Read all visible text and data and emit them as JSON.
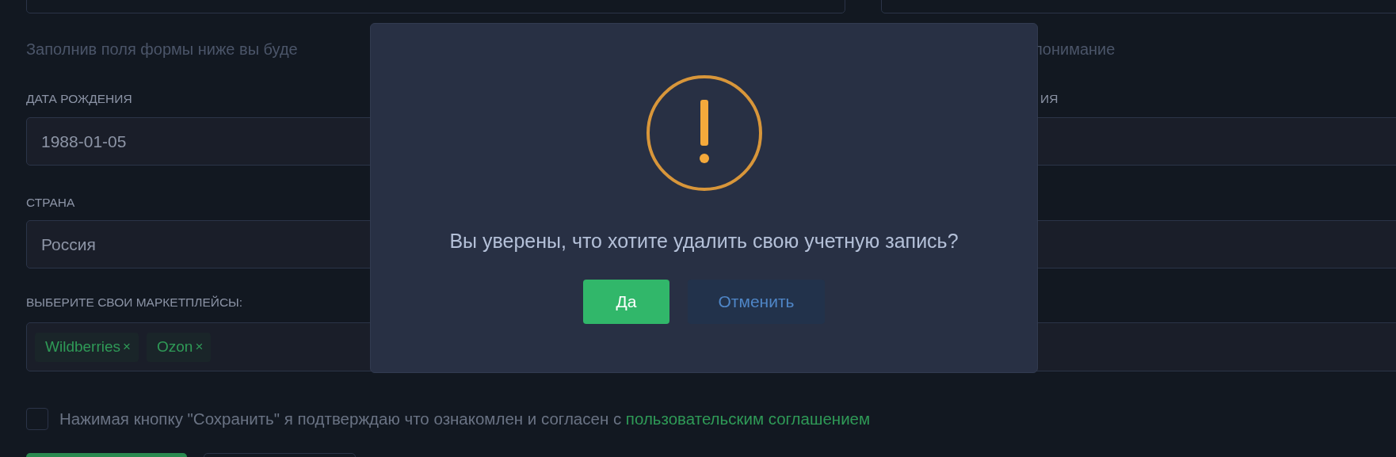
{
  "intro": {
    "text_left": "Заполнив поля формы ниже вы буде",
    "text_right": "понимание"
  },
  "birth_date": {
    "label": "ДАТА РОЖДЕНИЯ",
    "value": "1988-01-05"
  },
  "right_field": {
    "label": "ИЯ"
  },
  "country": {
    "label": "СТРАНА",
    "value": "Россия"
  },
  "marketplaces": {
    "label": "ВЫБЕРИТЕ СВОИ МАРКЕТПЛЕЙСЫ:",
    "tags": [
      {
        "label": "Wildberries",
        "remove": "×"
      },
      {
        "label": "Ozon",
        "remove": "×"
      }
    ]
  },
  "agreement": {
    "checked": false,
    "text": "Нажимая кнопку \"Сохранить\" я подтверждаю что ознакомлен и согласен с",
    "link": "пользовательским соглашением"
  },
  "dialog": {
    "message": "Вы уверены, что хотите удалить свою учетную запись?",
    "buttons": [
      {
        "label": "Да",
        "kind": "confirm"
      },
      {
        "label": "Отменить",
        "kind": "cancel"
      }
    ]
  }
}
